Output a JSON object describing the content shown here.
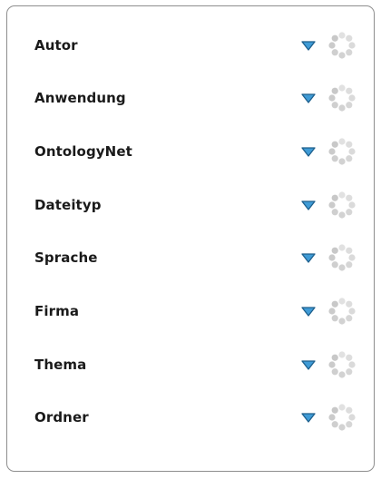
{
  "filters": [
    {
      "label": "Autor",
      "toggle_icon": "triangle-down-icon",
      "status_icon": "loading-spinner-icon"
    },
    {
      "label": "Anwendung",
      "toggle_icon": "triangle-down-icon",
      "status_icon": "loading-spinner-icon"
    },
    {
      "label": "OntologyNet",
      "toggle_icon": "triangle-down-icon",
      "status_icon": "loading-spinner-icon"
    },
    {
      "label": "Dateityp",
      "toggle_icon": "triangle-down-icon",
      "status_icon": "loading-spinner-icon"
    },
    {
      "label": "Sprache",
      "toggle_icon": "triangle-down-icon",
      "status_icon": "loading-spinner-icon"
    },
    {
      "label": "Firma",
      "toggle_icon": "triangle-down-icon",
      "status_icon": "loading-spinner-icon"
    },
    {
      "label": "Thema",
      "toggle_icon": "triangle-down-icon",
      "status_icon": "loading-spinner-icon"
    },
    {
      "label": "Ordner",
      "toggle_icon": "triangle-down-icon",
      "status_icon": "loading-spinner-icon"
    }
  ],
  "colors": {
    "panel_border": "#8e8e8e",
    "label_text": "#1a1a1a",
    "triangle_fill": "#3f9bd6",
    "triangle_stroke": "#1d5f8c",
    "spinner_dot": "#c8c8c8"
  }
}
